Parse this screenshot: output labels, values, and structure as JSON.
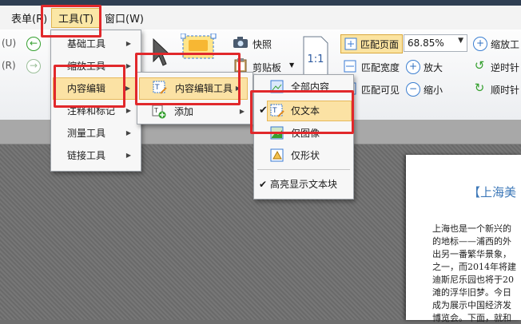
{
  "menubar": {
    "form": "表单(R)",
    "tools": "工具(T)",
    "window": "窗口(W)"
  },
  "ribbon": {
    "left_labels": [
      "(U)",
      "(R)"
    ],
    "snapshot": "快照",
    "clipboard": "剪贴板",
    "fit_page": "匹配页面",
    "fit_width": "匹配宽度",
    "fit_visible": "匹配可见",
    "zoom_value": "68.85%",
    "zoom_in_tool": "缩放工",
    "zoom_in": "放大",
    "zoom_out": "缩小",
    "rotate_ccw": "逆时针",
    "rotate_cw": "顺时针",
    "page_icon_text": "1:1"
  },
  "tools_menu": {
    "items": [
      {
        "label": "基础工具",
        "has_sub": true
      },
      {
        "label": "缩放工具",
        "has_sub": true
      },
      {
        "label": "内容编辑",
        "has_sub": true,
        "highlighted": true
      },
      {
        "label": "注释和标记",
        "has_sub": true
      },
      {
        "label": "测量工具",
        "has_sub": true
      },
      {
        "label": "链接工具",
        "has_sub": true
      }
    ]
  },
  "content_edit_menu": {
    "items": [
      {
        "label": "内容编辑工具",
        "has_sub": true,
        "highlighted": true
      },
      {
        "label": "添加",
        "has_sub": true
      }
    ]
  },
  "content_tool_menu": {
    "items": [
      {
        "label": "全部内容"
      },
      {
        "label": "仅文本",
        "checked": true,
        "highlighted": true
      },
      {
        "label": "仅图像"
      },
      {
        "label": "仅形状"
      },
      {
        "label": "高亮显示文本块",
        "checked": true
      }
    ]
  },
  "document": {
    "title": "【上海美",
    "lines": [
      "上海也是一个新兴的",
      "的地标——浦西的外",
      "出另一番繁华景象，",
      "之一，而2014年将建",
      "迪斯尼乐园也将于20",
      "滩的浮华旧梦。今日",
      "成为展示中国经济发",
      "博览会。下面，就和"
    ]
  },
  "colors": {
    "highlight": "#fbe2a4",
    "annotation": "#e1282b",
    "accent": "#3d78b8"
  }
}
